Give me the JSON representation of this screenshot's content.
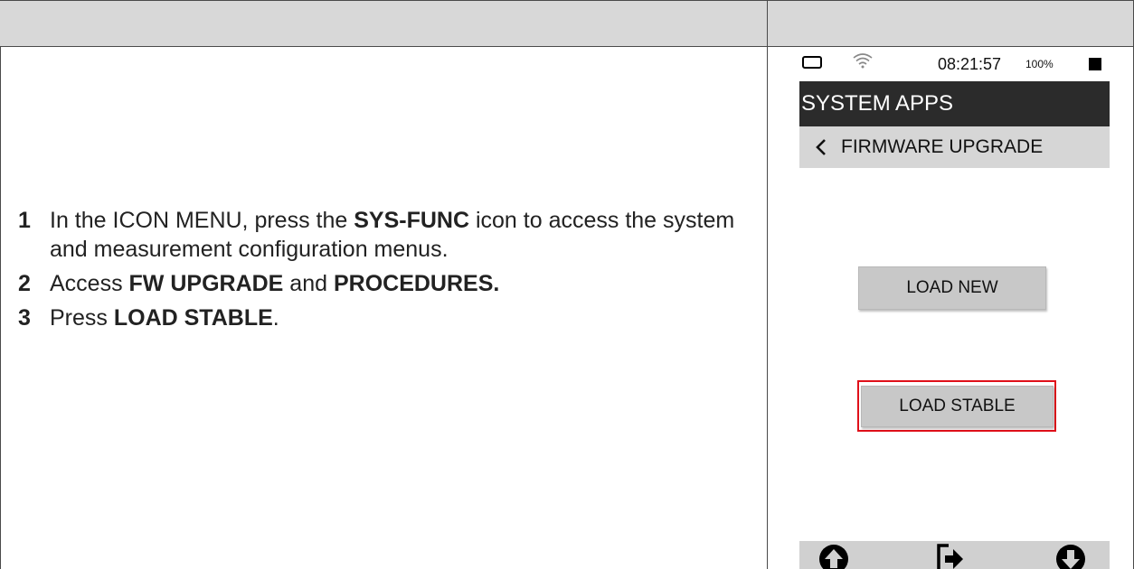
{
  "steps": [
    {
      "num": "1",
      "pre": "In the ICON MENU, press the ",
      "bold": "SYS-FUNC",
      "post": " icon to access the system and measurement configuration menus."
    },
    {
      "num": "2",
      "pre": "Access ",
      "bold": "FW UPGRADE",
      "mid": " and ",
      "bold2": "PROCEDURES.",
      "post": ""
    },
    {
      "num": "3",
      "pre": "Press ",
      "bold": "LOAD STABLE",
      "post": "."
    }
  ],
  "device": {
    "status": {
      "time": "08:21:57",
      "battery": "100%"
    },
    "title": "SYSTEM APPS",
    "subtitle": "FIRMWARE UPGRADE",
    "buttons": {
      "load_new": "LOAD NEW",
      "load_stable": "LOAD STABLE"
    },
    "bottom_icons": [
      "arrow-up-circle-icon",
      "exit-icon",
      "arrow-down-circle-icon"
    ],
    "highlight_color": "#e0101a"
  }
}
